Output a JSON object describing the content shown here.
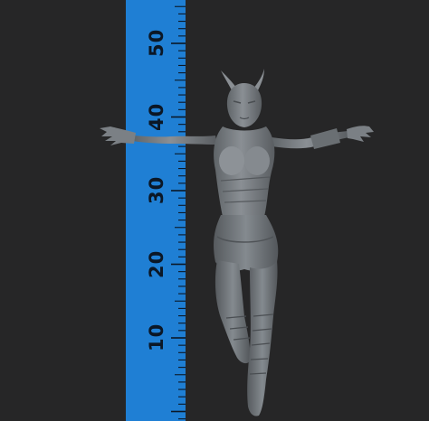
{
  "scene": {
    "background_color": "#262627",
    "ruler_color": "#1f7fd4",
    "tick_color": "#0b1726",
    "figure_color": "#7d8287",
    "figure_shadow_color": "#4a4e52"
  },
  "ruler": {
    "labels": [
      "10",
      "20",
      "30",
      "40",
      "50"
    ]
  }
}
